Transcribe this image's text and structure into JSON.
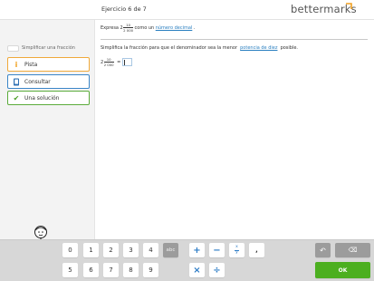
{
  "header": {
    "title": "Ejercicio 6 de 7",
    "logo": "bettermarks"
  },
  "sidebar": {
    "checkbox_label": "Simplificar una fracción",
    "checkbox_checked": false,
    "buttons": [
      {
        "label": "Pista",
        "icon": "info-icon",
        "color": "#f0a93a"
      },
      {
        "label": "Consultar",
        "icon": "book-icon",
        "color": "#3b86c8"
      },
      {
        "label": "Una solución",
        "icon": "check-icon",
        "color": "#5aab3a"
      }
    ]
  },
  "task": {
    "prefix": "Expresa",
    "whole": "2",
    "num": "10",
    "den": "2 000",
    "middle": "como un",
    "link": "número decimal",
    "suffix": "."
  },
  "instruction": {
    "text1": "Simplifica la fracción para que el denominador sea la menor",
    "link": "potencia de diez",
    "text2": "posible."
  },
  "equation": {
    "whole": "2",
    "num": "10",
    "den": "2 000",
    "equals": "=",
    "answer_value": ""
  },
  "keypad": {
    "digits_row1": [
      "0",
      "1",
      "2",
      "3",
      "4"
    ],
    "digits_row2": [
      "5",
      "6",
      "7",
      "8",
      "9"
    ],
    "abc": "abc",
    "plus": "+",
    "minus": "−",
    "frac_x": "x",
    "frac_y": "y",
    "decimal": ",",
    "times": "×",
    "divide": "÷",
    "undo": "↶",
    "backspace": "⌫",
    "ok": "OK"
  }
}
